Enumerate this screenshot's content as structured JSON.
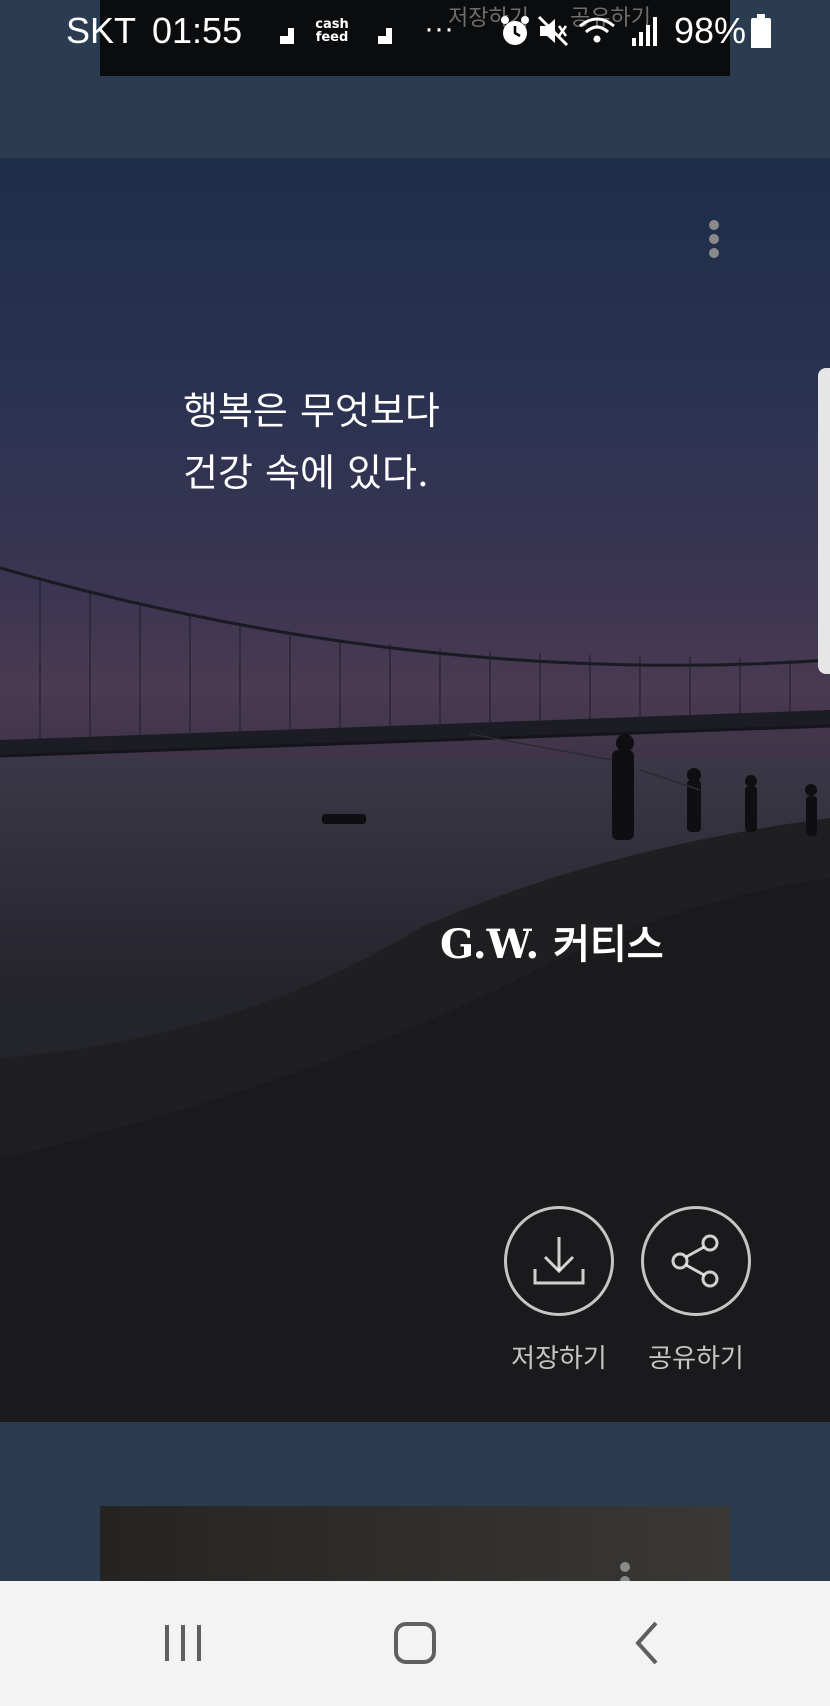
{
  "status_bar": {
    "carrier": "SKT",
    "time": "01:55",
    "battery": "98%",
    "overflow": "···",
    "cashfeed_top": "cash",
    "cashfeed_bottom": "feed",
    "icons": [
      "stairs-icon",
      "cashfeed-icon",
      "stairs-icon",
      "more-dots-icon",
      "alarm-icon",
      "mute-icon",
      "wifi-icon",
      "signal-icon",
      "battery-icon"
    ]
  },
  "ghost_card": {
    "save_label": "저장하기",
    "share_label": "공유하기"
  },
  "card": {
    "quote_line1": "행복은 무엇보다",
    "quote_line2": "건강 속에 있다.",
    "author": "G.W. 커티스",
    "save_label": "저장하기",
    "share_label": "공유하기",
    "menu_icon": "more-vertical-icon",
    "save_icon": "download-icon",
    "share_icon": "share-icon"
  },
  "nav_bar": {
    "icons": [
      "recent-apps-icon",
      "home-icon",
      "back-icon"
    ]
  },
  "colors": {
    "page_bg": "#2b3c51",
    "nav_bg": "#f3f3f3",
    "nav_icon": "#5f5f5f"
  }
}
